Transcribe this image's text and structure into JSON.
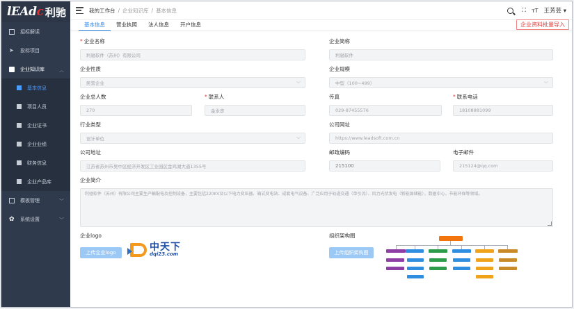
{
  "logo": {
    "en_a": "lEAd",
    "en_b": "c",
    "cn": "利驰"
  },
  "sidebar": {
    "items": [
      {
        "label": "招标解读"
      },
      {
        "label": "投标项目"
      },
      {
        "label": "企业知识库"
      },
      {
        "label": "模板管理"
      },
      {
        "label": "系统设置"
      }
    ],
    "subitems": [
      {
        "label": "基本信息"
      },
      {
        "label": "项目人员"
      },
      {
        "label": "企业证书"
      },
      {
        "label": "企业业绩"
      },
      {
        "label": "财务信息"
      },
      {
        "label": "企业产品库"
      }
    ]
  },
  "header": {
    "breadcrumb": [
      "我的工作台",
      "企业知识库",
      "基本信息"
    ],
    "user": "王芳芸",
    "user_caret": "▾",
    "expand_icon": "⛶",
    "font_icon": "тT"
  },
  "tabs": [
    "基本信息",
    "营业执照",
    "法人信息",
    "开户信息"
  ],
  "import_button": "企业资料批量导入",
  "form": {
    "company_name": {
      "label": "企业名称",
      "value": "利驰软件（苏州）有限公司"
    },
    "short_name": {
      "label": "企业简称",
      "value": "利驰软件"
    },
    "nature": {
      "label": "企业性质",
      "value": "民营企业"
    },
    "scale": {
      "label": "企业规模",
      "value": "中型（100~499）"
    },
    "headcount": {
      "label": "企业总人数",
      "value": "270"
    },
    "contact": {
      "label": "联系人",
      "value": "金永彦"
    },
    "fax": {
      "label": "传真",
      "value": "029-87455576"
    },
    "phone": {
      "label": "联系电话",
      "value": "18108881099"
    },
    "industry": {
      "label": "行业类型",
      "value": "设计单位"
    },
    "website": {
      "label": "公司网址",
      "value": "https://www.leadsoft.com.cn"
    },
    "address": {
      "label": "公司地址",
      "value": "江苏省苏州市吴中区经济开发区工业园区金鸡湖大道1355号"
    },
    "postcode": {
      "label": "邮政编码",
      "value": "215100"
    },
    "email": {
      "label": "电子邮件",
      "value": "215124@qq.com"
    },
    "intro": {
      "label": "企业简介",
      "value": "利驰软件（苏州）有限公司主要生产輸配电及控制设备，主要包括220KV及以下电力变压器、箱式变电站、成套电气设备、广泛应用于轨道交通（单引流）、风力光伏发电（新能源储能），数据中心，节能环保等领域。"
    },
    "logo": {
      "label": "企业logo",
      "button": "上传企业logo"
    },
    "org": {
      "label": "组织架构图",
      "button": "上传组织架构图"
    }
  },
  "logo_preview": {
    "name": "中天下",
    "domain": "dqi23.com"
  },
  "colors": {
    "sidebar_bg": "#2f3a4c",
    "accent": "#2b85e4",
    "required": "#e23b3b"
  }
}
